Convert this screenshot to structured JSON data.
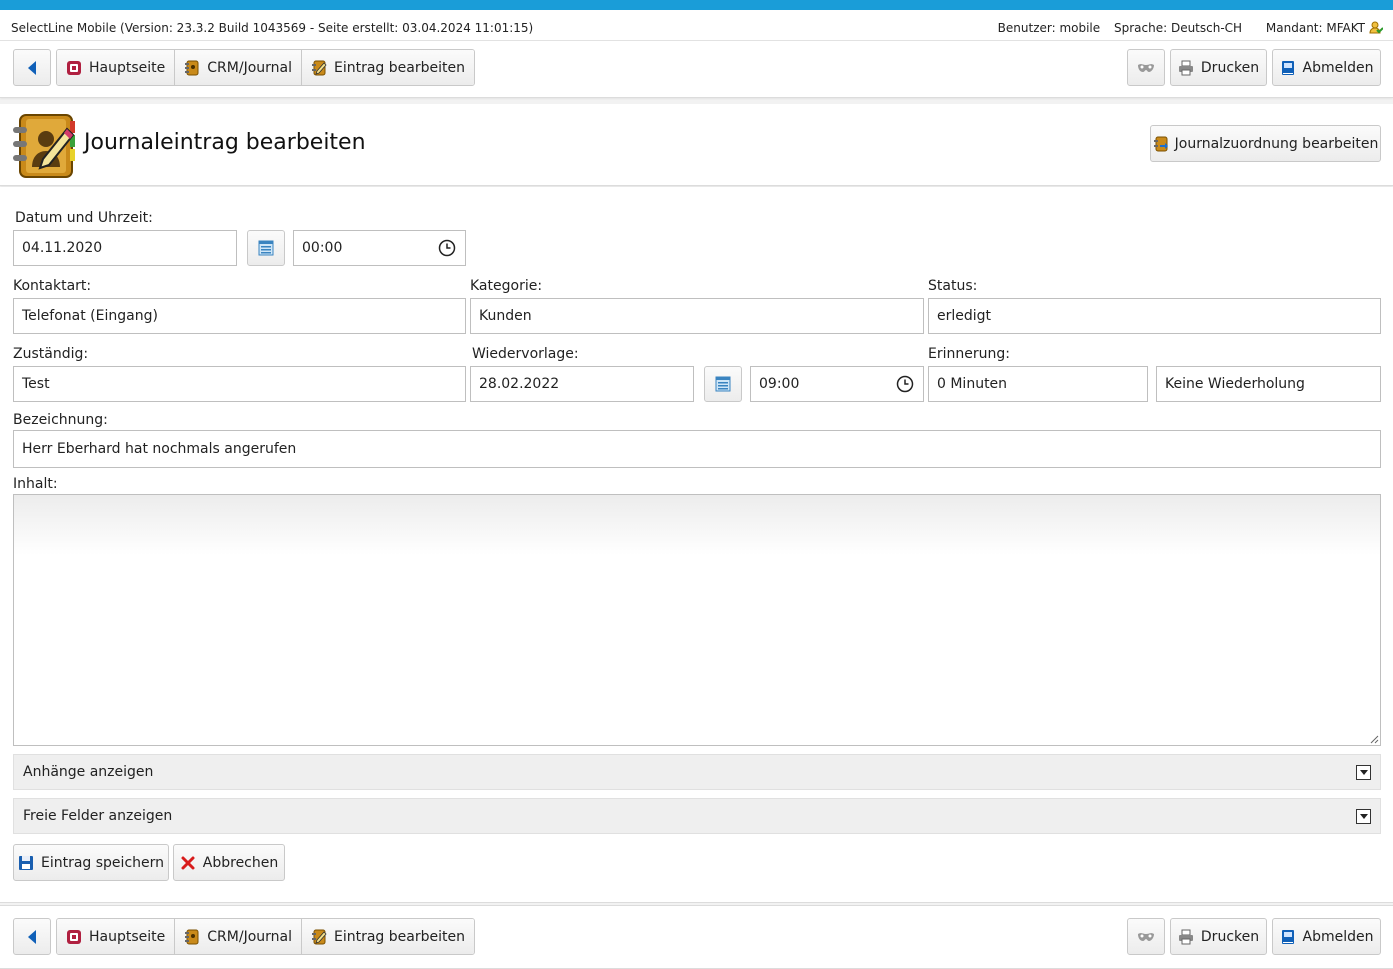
{
  "info": {
    "app_version": "SelectLine Mobile (Version: 23.3.2 Build 1043569 - Seite erstellt: 03.04.2024 11:01:15)",
    "user": "Benutzer: mobile",
    "language": "Sprache: Deutsch-CH",
    "client": "Mandant: MFAKT"
  },
  "nav": {
    "back_icon": "back-arrow-icon",
    "breadcrumb": [
      {
        "label": "Hauptseite",
        "icon": "home-icon"
      },
      {
        "label": "CRM/Journal",
        "icon": "journal-icon"
      },
      {
        "label": "Eintrag bearbeiten",
        "icon": "edit-icon"
      }
    ],
    "mask_icon": "mask-icon",
    "print_label": "Drucken",
    "logout_label": "Abmelden"
  },
  "header": {
    "title": "Journaleintrag bearbeiten",
    "assign_button": "Journalzuordnung bearbeiten"
  },
  "form": {
    "datetime_label": "Datum und Uhrzeit:",
    "date_value": "04.11.2020",
    "time_value": "00:00",
    "contact_type_label": "Kontaktart:",
    "contact_type_value": "Telefonat (Eingang)",
    "category_label": "Kategorie:",
    "category_value": "Kunden",
    "status_label": "Status:",
    "status_value": "erledigt",
    "responsible_label": "Zuständig:",
    "responsible_value": "Test",
    "followup_label": "Wiedervorlage:",
    "followup_date": "28.02.2022",
    "followup_time": "09:00",
    "reminder_label": "Erinnerung:",
    "reminder_value": "0 Minuten",
    "repeat_value": "Keine Wiederholung",
    "designation_label": "Bezeichnung:",
    "designation_value": "Herr Eberhard hat nochmals angerufen",
    "content_label": "Inhalt:",
    "content_value": "",
    "attachments_label": "Anhänge anzeigen",
    "free_fields_label": "Freie Felder anzeigen",
    "save_label": "Eintrag speichern",
    "cancel_label": "Abbrechen"
  },
  "colors": {
    "accent": "#1a9dd8"
  }
}
